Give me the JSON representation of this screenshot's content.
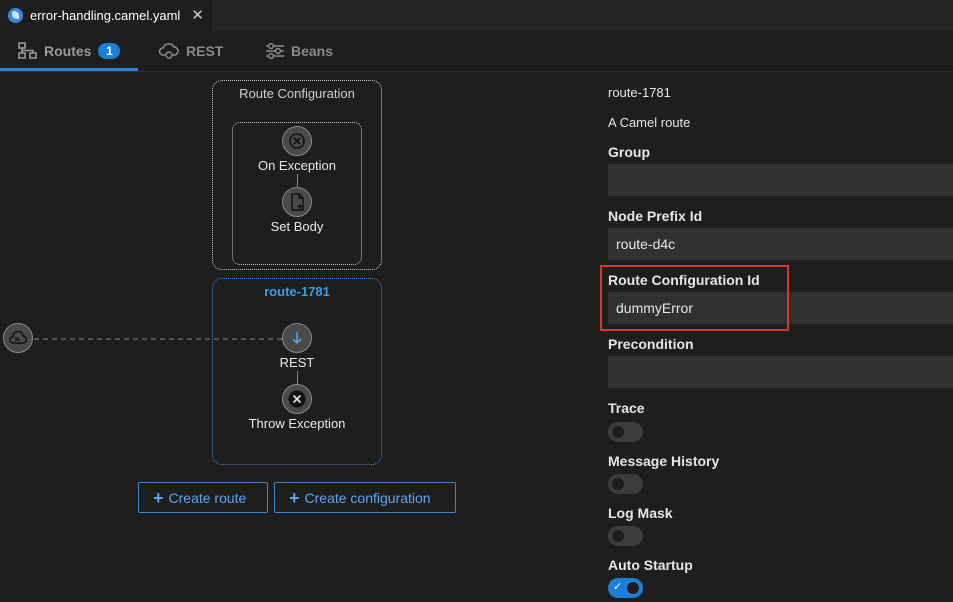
{
  "editor": {
    "file_tab": "error-handling.camel.yaml",
    "close_glyph": "✕"
  },
  "view_tabs": {
    "routes": {
      "label": "Routes",
      "badge": "1"
    },
    "rest": {
      "label": "REST"
    },
    "beans": {
      "label": "Beans"
    }
  },
  "canvas": {
    "route_configuration": {
      "title": "Route Configuration",
      "nodes": [
        {
          "label": "On Exception",
          "icon": "on-exception-icon"
        },
        {
          "label": "Set Body",
          "icon": "set-body-icon"
        }
      ]
    },
    "route": {
      "title": "route-1781",
      "nodes": [
        {
          "label": "REST",
          "icon": "rest-icon"
        },
        {
          "label": "Throw Exception",
          "icon": "throw-exception-icon"
        }
      ]
    },
    "buttons": {
      "create_route": "Create route",
      "create_configuration": "Create configuration"
    }
  },
  "panel": {
    "route_id": "route-1781",
    "description": "A Camel route",
    "fields": {
      "group": {
        "label": "Group",
        "value": ""
      },
      "node_prefix_id": {
        "label": "Node Prefix Id",
        "value": "route-d4c"
      },
      "route_configuration_id": {
        "label": "Route Configuration Id",
        "value": "dummyError"
      },
      "precondition": {
        "label": "Precondition",
        "value": ""
      }
    },
    "toggles": {
      "trace": {
        "label": "Trace",
        "on": false
      },
      "message_history": {
        "label": "Message History",
        "on": false
      },
      "log_mask": {
        "label": "Log Mask",
        "on": false
      },
      "auto_startup": {
        "label": "Auto Startup",
        "on": true
      }
    }
  },
  "colors": {
    "accent": "#1f7fd6",
    "highlight": "#d8372b",
    "route_title": "#3a9de6"
  }
}
